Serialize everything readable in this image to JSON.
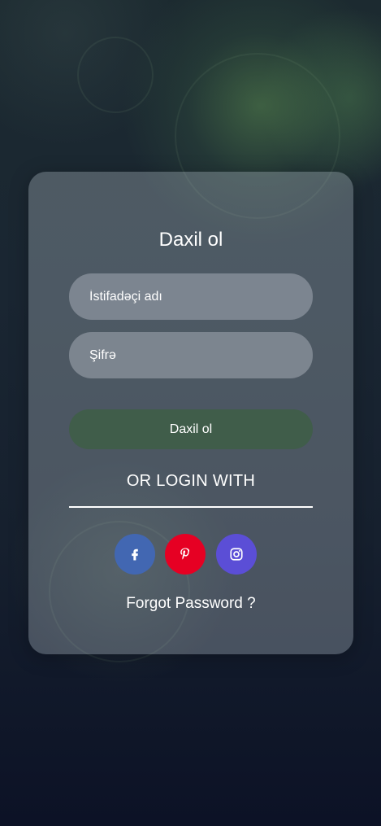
{
  "form": {
    "title": "Daxil ol",
    "username_placeholder": "İstifadəçi adı",
    "password_placeholder": "Şifrə",
    "submit_label": "Daxil ol",
    "or_text": "OR LOGIN WITH",
    "forgot_password": "Forgot Password ?"
  },
  "social": [
    {
      "name": "facebook",
      "icon": "facebook-icon",
      "color": "#4267b2"
    },
    {
      "name": "pinterest",
      "icon": "pinterest-icon",
      "color": "#e60023"
    },
    {
      "name": "instagram",
      "icon": "instagram-icon",
      "color": "#5b4ed6"
    }
  ],
  "colors": {
    "submit_bg": "#3c5f41",
    "text": "#ffffff"
  }
}
